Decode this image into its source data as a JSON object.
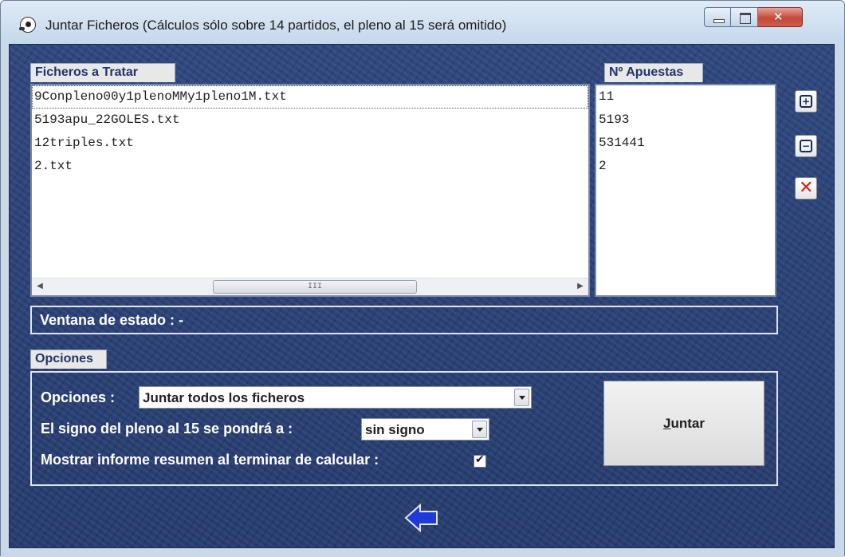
{
  "window": {
    "title": "Juntar Ficheros (Cálculos sólo sobre 14 partidos, el pleno al 15 será omitido)"
  },
  "files_panel": {
    "label": "Ficheros a Tratar",
    "items": [
      "9Conpleno00y1plenoMMy1pleno1M.txt",
      "5193apu_22GOLES.txt",
      "12triples.txt",
      "2.txt"
    ],
    "scroll_thumb_glyph": "III"
  },
  "bets_panel": {
    "label": "Nº Apuestas",
    "items": [
      "11",
      "5193",
      "531441",
      "2"
    ]
  },
  "side_buttons": {
    "add_icon": "plus-box-icon",
    "remove_icon": "minus-box-icon",
    "delete_icon": "red-x-icon"
  },
  "status": {
    "text": "Ventana de estado : -"
  },
  "options": {
    "tab_label": "Opciones",
    "opciones_label": "Opciones :",
    "opciones_value": "Juntar todos los ficheros",
    "pleno_label": "El signo del pleno al 15 se pondrá a :",
    "pleno_value": "sin signo",
    "report_label": "Mostrar informe resumen al terminar de calcular :",
    "report_checked": true,
    "juntar_first": "J",
    "juntar_rest": "untar"
  },
  "colors": {
    "background": "#273f74",
    "label_text": "#1f3568",
    "back_arrow": "#1f3ad6"
  }
}
